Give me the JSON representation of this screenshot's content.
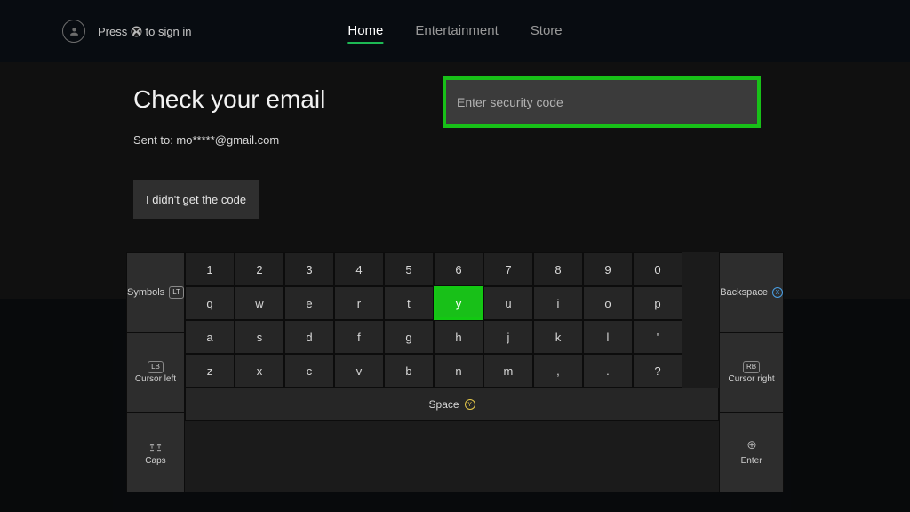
{
  "header": {
    "sign_in_prefix": "Press",
    "sign_in_suffix": "to sign in",
    "nav": [
      {
        "label": "Home",
        "active": true
      },
      {
        "label": "Entertainment",
        "active": false
      },
      {
        "label": "Store",
        "active": false
      }
    ]
  },
  "page": {
    "title": "Check your email",
    "sent_to": "Sent to: mo*****@gmail.com",
    "didnt_get_label": "I didn't get the code",
    "code_input_placeholder": "Enter security code"
  },
  "keyboard": {
    "symbols_label": "Symbols",
    "symbols_bumper": "LT",
    "cursor_left_label": "Cursor left",
    "cursor_left_bumper": "LB",
    "cursor_right_label": "Cursor right",
    "cursor_right_bumper": "RB",
    "caps_label": "Caps",
    "backspace_label": "Backspace",
    "backspace_btn": "X",
    "enter_label": "Enter",
    "space_label": "Space",
    "space_btn": "Y",
    "highlighted": "y",
    "rows": [
      [
        "1",
        "2",
        "3",
        "4",
        "5",
        "6",
        "7",
        "8",
        "9",
        "0"
      ],
      [
        "q",
        "w",
        "e",
        "r",
        "t",
        "y",
        "u",
        "i",
        "o",
        "p"
      ],
      [
        "a",
        "s",
        "d",
        "f",
        "g",
        "h",
        "j",
        "k",
        "l",
        "'"
      ],
      [
        "z",
        "x",
        "c",
        "v",
        "b",
        "n",
        "m",
        ",",
        ".",
        "?"
      ]
    ]
  }
}
